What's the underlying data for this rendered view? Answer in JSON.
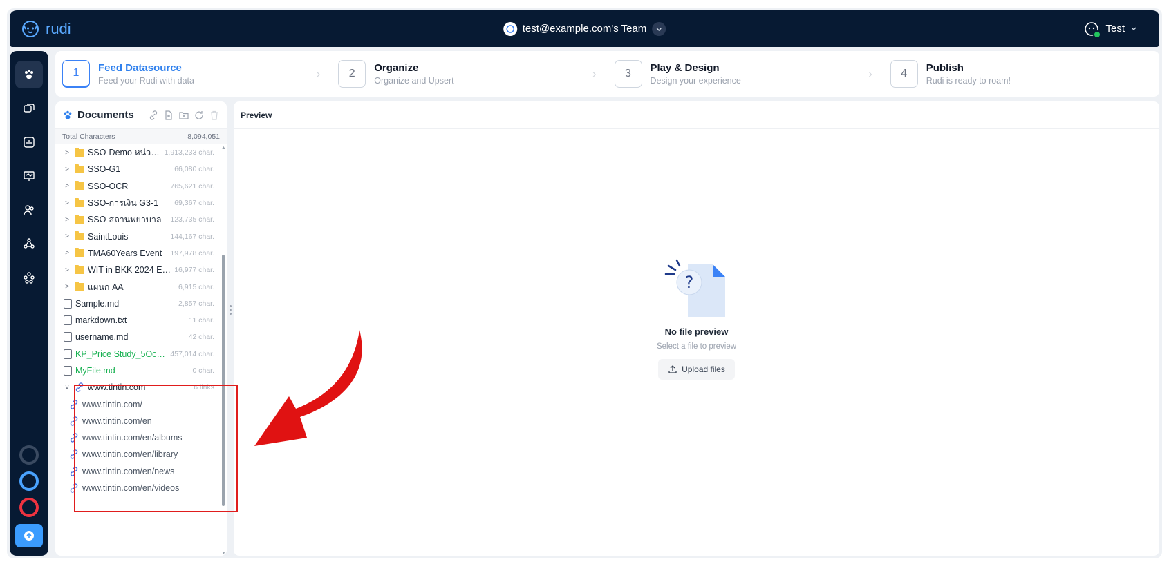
{
  "app": {
    "brand": "rudi",
    "team": "test@example.com's Team",
    "user": "Test"
  },
  "steps": [
    {
      "num": "1",
      "title": "Feed Datasource",
      "sub": "Feed your Rudi with data"
    },
    {
      "num": "2",
      "title": "Organize",
      "sub": "Organize and Upsert"
    },
    {
      "num": "3",
      "title": "Play & Design",
      "sub": "Design your experience"
    },
    {
      "num": "4",
      "title": "Publish",
      "sub": "Rudi is ready to roam!"
    }
  ],
  "docs": {
    "title": "Documents",
    "total_label": "Total Characters",
    "total_value": "8,094,051",
    "folders": [
      {
        "name": "SSO-Demo หน่วย ...",
        "count": "1,913,233 char."
      },
      {
        "name": "SSO-G1",
        "count": "66,080 char."
      },
      {
        "name": "SSO-OCR",
        "count": "765,621 char."
      },
      {
        "name": "SSO-การเงิน G3-1",
        "count": "69,367 char."
      },
      {
        "name": "SSO-สถานพยาบาล",
        "count": "123,735 char."
      },
      {
        "name": "SaintLouis",
        "count": "144,167 char."
      },
      {
        "name": "TMA60Years Event",
        "count": "197,978 char."
      },
      {
        "name": "WIT in BKK 2024 Ev...",
        "count": "16,977 char."
      },
      {
        "name": "แผนก AA",
        "count": "6,915 char."
      }
    ],
    "files": [
      {
        "name": "Sample.md",
        "count": "2,857 char."
      },
      {
        "name": "markdown.txt",
        "count": "11 char."
      },
      {
        "name": "username.md",
        "count": "42 char."
      },
      {
        "name": "KP_Price Study_5Oct2...",
        "count": "457,014 char."
      },
      {
        "name": "MyFile.md",
        "count": "0 char."
      }
    ],
    "site": {
      "name": "www.tintin.com",
      "count": "6 links"
    },
    "links": [
      "www.tintin.com/",
      "www.tintin.com/en",
      "www.tintin.com/en/albums",
      "www.tintin.com/en/library",
      "www.tintin.com/en/news",
      "www.tintin.com/en/videos"
    ]
  },
  "preview": {
    "title": "Preview",
    "empty_title": "No file preview",
    "empty_sub": "Select a file to preview",
    "upload_label": "Upload files"
  },
  "colors": {
    "nav_bg": "#071a33",
    "accent": "#2f80ed",
    "green": "#16b050",
    "annotation": "#e01d1d"
  }
}
